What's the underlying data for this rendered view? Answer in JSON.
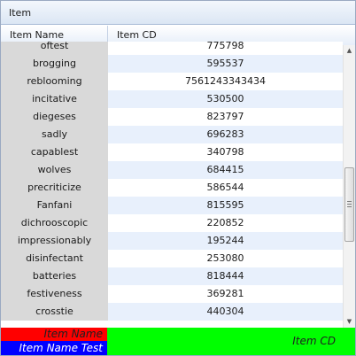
{
  "panel": {
    "title": "Item"
  },
  "columns": {
    "name": "Item Name",
    "cd": "Item CD"
  },
  "rows": [
    {
      "name": "oftest",
      "cd": "775798"
    },
    {
      "name": "brogging",
      "cd": "595537"
    },
    {
      "name": "reblooming",
      "cd": "7561243343434"
    },
    {
      "name": "incitative",
      "cd": "530500"
    },
    {
      "name": "diegeses",
      "cd": "823797"
    },
    {
      "name": "sadly",
      "cd": "696283"
    },
    {
      "name": "capablest",
      "cd": "340798"
    },
    {
      "name": "wolves",
      "cd": "684415"
    },
    {
      "name": "precriticize",
      "cd": "586544"
    },
    {
      "name": "Fanfani",
      "cd": "815595"
    },
    {
      "name": "dichrooscopic",
      "cd": "220852"
    },
    {
      "name": "impressionably",
      "cd": "195244"
    },
    {
      "name": "disinfectant",
      "cd": "253080"
    },
    {
      "name": "batteries",
      "cd": "818444"
    },
    {
      "name": "festiveness",
      "cd": "369281"
    },
    {
      "name": "crosstie",
      "cd": "440304"
    }
  ],
  "footer": {
    "name_top": "Item Name",
    "name_bottom": "Item Name Test",
    "cd": "Item CD",
    "colors": {
      "name_top": "#ff0000",
      "name_bottom": "#0000ff",
      "cd": "#00ff00"
    }
  },
  "icons": {
    "scroll_up": "arrow-up-icon",
    "scroll_down": "arrow-down-icon"
  }
}
